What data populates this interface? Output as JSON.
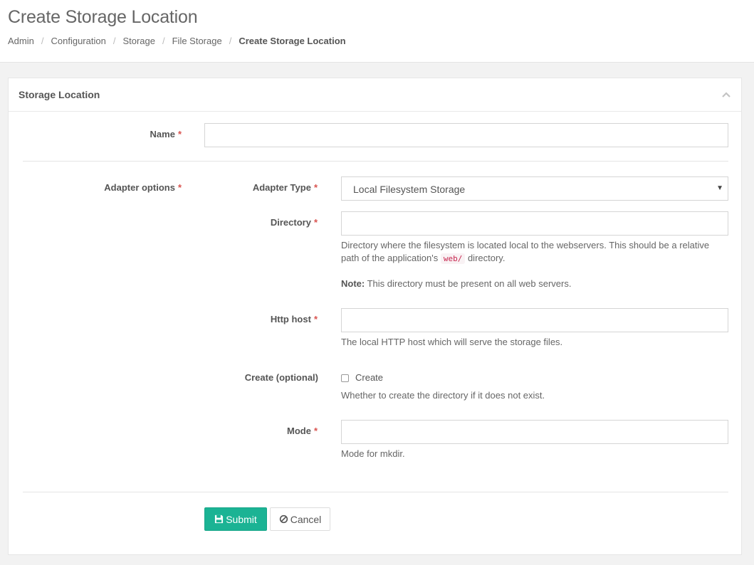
{
  "page": {
    "title": "Create Storage Location",
    "breadcrumb": [
      "Admin",
      "Configuration",
      "Storage",
      "File Storage"
    ],
    "breadcrumb_current": "Create Storage Location",
    "breadcrumb_separator": "/"
  },
  "panel": {
    "title": "Storage Location",
    "collapse_icon": "chevron-up-icon"
  },
  "form": {
    "name_label": "Name",
    "name_value": "",
    "required_marker": "*",
    "adapter_options_label": "Adapter options",
    "adapter_type_label": "Adapter Type",
    "adapter_type_value": "Local Filesystem Storage",
    "directory_label": "Directory",
    "directory_value": "",
    "directory_help_1": "Directory where the filesystem is located local to the webservers. This should be a relative",
    "directory_help_2a": "path of the application's",
    "directory_help_code": "web/",
    "directory_help_2b": "directory.",
    "directory_note_label": "Note:",
    "directory_note_text": "This directory must be present on all web servers.",
    "http_host_label": "Http host",
    "http_host_value": "",
    "http_host_help": "The local HTTP host which will serve the storage files.",
    "create_label": "Create (optional)",
    "create_checkbox_label": "Create",
    "create_checked": false,
    "create_help": "Whether to create the directory if it does not exist.",
    "mode_label": "Mode",
    "mode_value": "",
    "mode_help": "Mode for mkdir.",
    "submit_label": "Submit",
    "submit_icon": "save-icon",
    "cancel_label": "Cancel",
    "cancel_icon": "ban-icon"
  },
  "colors": {
    "accent": "#1bb394",
    "required": "#d9534f",
    "code_text": "#c7254e"
  }
}
